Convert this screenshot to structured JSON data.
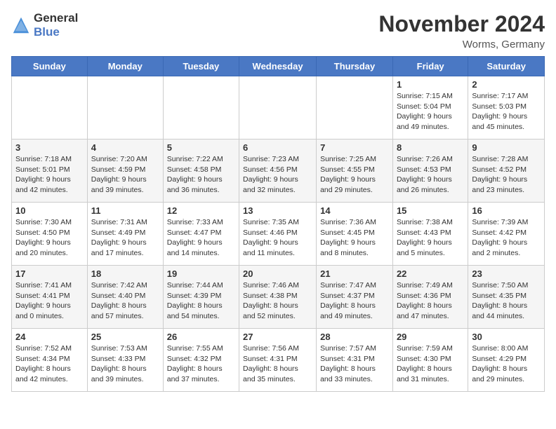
{
  "logo": {
    "general": "General",
    "blue": "Blue"
  },
  "header": {
    "month": "November 2024",
    "location": "Worms, Germany"
  },
  "weekdays": [
    "Sunday",
    "Monday",
    "Tuesday",
    "Wednesday",
    "Thursday",
    "Friday",
    "Saturday"
  ],
  "weeks": [
    [
      {
        "day": "",
        "info": ""
      },
      {
        "day": "",
        "info": ""
      },
      {
        "day": "",
        "info": ""
      },
      {
        "day": "",
        "info": ""
      },
      {
        "day": "",
        "info": ""
      },
      {
        "day": "1",
        "info": "Sunrise: 7:15 AM\nSunset: 5:04 PM\nDaylight: 9 hours and 49 minutes."
      },
      {
        "day": "2",
        "info": "Sunrise: 7:17 AM\nSunset: 5:03 PM\nDaylight: 9 hours and 45 minutes."
      }
    ],
    [
      {
        "day": "3",
        "info": "Sunrise: 7:18 AM\nSunset: 5:01 PM\nDaylight: 9 hours and 42 minutes."
      },
      {
        "day": "4",
        "info": "Sunrise: 7:20 AM\nSunset: 4:59 PM\nDaylight: 9 hours and 39 minutes."
      },
      {
        "day": "5",
        "info": "Sunrise: 7:22 AM\nSunset: 4:58 PM\nDaylight: 9 hours and 36 minutes."
      },
      {
        "day": "6",
        "info": "Sunrise: 7:23 AM\nSunset: 4:56 PM\nDaylight: 9 hours and 32 minutes."
      },
      {
        "day": "7",
        "info": "Sunrise: 7:25 AM\nSunset: 4:55 PM\nDaylight: 9 hours and 29 minutes."
      },
      {
        "day": "8",
        "info": "Sunrise: 7:26 AM\nSunset: 4:53 PM\nDaylight: 9 hours and 26 minutes."
      },
      {
        "day": "9",
        "info": "Sunrise: 7:28 AM\nSunset: 4:52 PM\nDaylight: 9 hours and 23 minutes."
      }
    ],
    [
      {
        "day": "10",
        "info": "Sunrise: 7:30 AM\nSunset: 4:50 PM\nDaylight: 9 hours and 20 minutes."
      },
      {
        "day": "11",
        "info": "Sunrise: 7:31 AM\nSunset: 4:49 PM\nDaylight: 9 hours and 17 minutes."
      },
      {
        "day": "12",
        "info": "Sunrise: 7:33 AM\nSunset: 4:47 PM\nDaylight: 9 hours and 14 minutes."
      },
      {
        "day": "13",
        "info": "Sunrise: 7:35 AM\nSunset: 4:46 PM\nDaylight: 9 hours and 11 minutes."
      },
      {
        "day": "14",
        "info": "Sunrise: 7:36 AM\nSunset: 4:45 PM\nDaylight: 9 hours and 8 minutes."
      },
      {
        "day": "15",
        "info": "Sunrise: 7:38 AM\nSunset: 4:43 PM\nDaylight: 9 hours and 5 minutes."
      },
      {
        "day": "16",
        "info": "Sunrise: 7:39 AM\nSunset: 4:42 PM\nDaylight: 9 hours and 2 minutes."
      }
    ],
    [
      {
        "day": "17",
        "info": "Sunrise: 7:41 AM\nSunset: 4:41 PM\nDaylight: 9 hours and 0 minutes."
      },
      {
        "day": "18",
        "info": "Sunrise: 7:42 AM\nSunset: 4:40 PM\nDaylight: 8 hours and 57 minutes."
      },
      {
        "day": "19",
        "info": "Sunrise: 7:44 AM\nSunset: 4:39 PM\nDaylight: 8 hours and 54 minutes."
      },
      {
        "day": "20",
        "info": "Sunrise: 7:46 AM\nSunset: 4:38 PM\nDaylight: 8 hours and 52 minutes."
      },
      {
        "day": "21",
        "info": "Sunrise: 7:47 AM\nSunset: 4:37 PM\nDaylight: 8 hours and 49 minutes."
      },
      {
        "day": "22",
        "info": "Sunrise: 7:49 AM\nSunset: 4:36 PM\nDaylight: 8 hours and 47 minutes."
      },
      {
        "day": "23",
        "info": "Sunrise: 7:50 AM\nSunset: 4:35 PM\nDaylight: 8 hours and 44 minutes."
      }
    ],
    [
      {
        "day": "24",
        "info": "Sunrise: 7:52 AM\nSunset: 4:34 PM\nDaylight: 8 hours and 42 minutes."
      },
      {
        "day": "25",
        "info": "Sunrise: 7:53 AM\nSunset: 4:33 PM\nDaylight: 8 hours and 39 minutes."
      },
      {
        "day": "26",
        "info": "Sunrise: 7:55 AM\nSunset: 4:32 PM\nDaylight: 8 hours and 37 minutes."
      },
      {
        "day": "27",
        "info": "Sunrise: 7:56 AM\nSunset: 4:31 PM\nDaylight: 8 hours and 35 minutes."
      },
      {
        "day": "28",
        "info": "Sunrise: 7:57 AM\nSunset: 4:31 PM\nDaylight: 8 hours and 33 minutes."
      },
      {
        "day": "29",
        "info": "Sunrise: 7:59 AM\nSunset: 4:30 PM\nDaylight: 8 hours and 31 minutes."
      },
      {
        "day": "30",
        "info": "Sunrise: 8:00 AM\nSunset: 4:29 PM\nDaylight: 8 hours and 29 minutes."
      }
    ]
  ]
}
